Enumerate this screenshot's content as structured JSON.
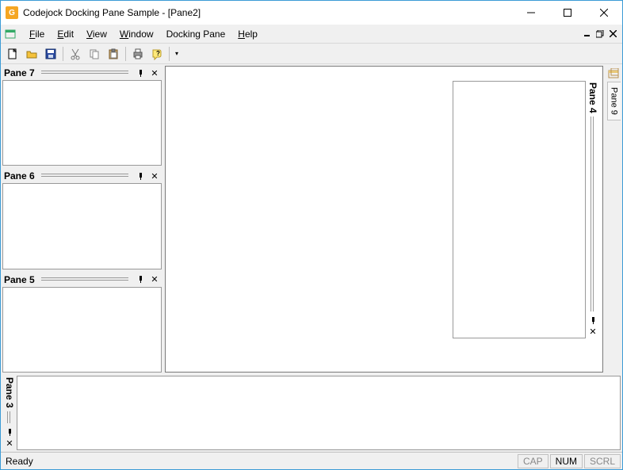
{
  "title": "Codejock Docking Pane Sample - [Pane2]",
  "menu": {
    "file": "File",
    "edit": "Edit",
    "view": "View",
    "window": "Window",
    "docking_pane": "Docking Pane",
    "help": "Help"
  },
  "panes": {
    "p7": "Pane 7",
    "p6": "Pane 6",
    "p5": "Pane 5",
    "p4": "Pane 4",
    "p3": "Pane 3",
    "p9": "Pane 9"
  },
  "status": {
    "ready": "Ready",
    "cap": "CAP",
    "num": "NUM",
    "scrl": "SCRL"
  }
}
